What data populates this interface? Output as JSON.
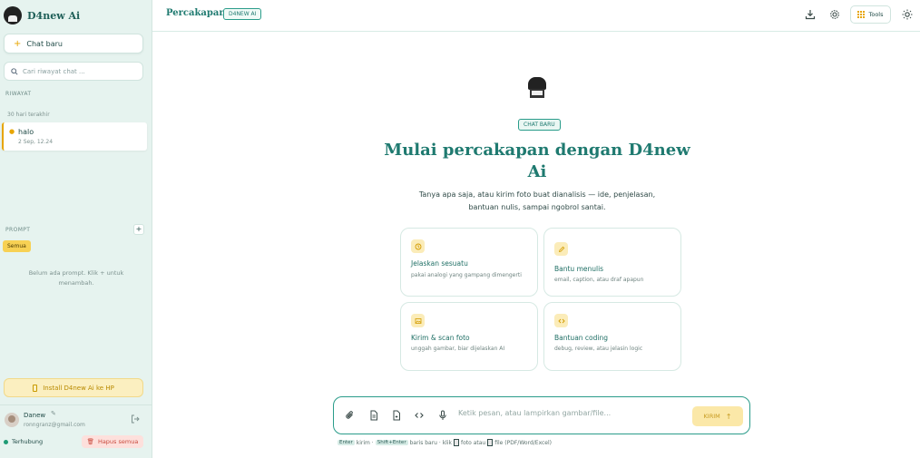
{
  "sidebar": {
    "brand": "D4new Ai",
    "new_chat": "Chat baru",
    "search_placeholder": "Cari riwayat chat ...",
    "history_label": "RIWAYAT",
    "group_label": "30 hari terakhir",
    "conversations": [
      {
        "title": "halo",
        "meta": "2 Sep, 12.24"
      }
    ],
    "prompt_label": "PROMPT",
    "prompt_add": "+",
    "prompt_filter": "Semua",
    "prompt_empty": "Belum ada prompt. Klik + untuk menambah.",
    "install": "Install D4new Ai ke HP",
    "user": {
      "name": "Danew",
      "email": "ronngranz@gmail.com"
    },
    "status": "Terhubung",
    "clear_all": "Hapus semua"
  },
  "topbar": {
    "title": "Percakapan",
    "badge": "D4NEW AI",
    "tools": "Tools",
    "icons": [
      "download-icon",
      "gear-icon",
      "sun-icon"
    ]
  },
  "hero": {
    "badge": "CHAT BARU",
    "title": "Mulai percakapan dengan D4new Ai",
    "subtitle": "Tanya apa saja, atau kirim foto buat dianalisis — ide, penjelasan, bantuan nulis, sampai ngobrol santai."
  },
  "cards": [
    {
      "title": "Jelaskan sesuatu",
      "desc": "pakai analogi yang gampang dimengerti",
      "icon": "clock-icon"
    },
    {
      "title": "Bantu menulis",
      "desc": "email, caption, atau draf apapun",
      "icon": "pencil-icon"
    },
    {
      "title": "Kirim & scan foto",
      "desc": "unggah gambar, biar dijelaskan AI",
      "icon": "image-icon"
    },
    {
      "title": "Bantuan coding",
      "desc": "debug, review, atau jelasin logic",
      "icon": "code-icon"
    }
  ],
  "composer": {
    "placeholder": "Ketik pesan, atau lampirkan gambar/file...",
    "send": "KIRIM",
    "icons": [
      "paperclip-icon",
      "document-icon",
      "file-icon",
      "code-icon",
      "mic-icon"
    ]
  },
  "hint": {
    "enter": "Enter",
    "send_text": "kirim ·",
    "shift_enter": "Shift+Enter",
    "newline_text": "baris baru · klik",
    "photo_text": "foto atau",
    "file_text": "file (PDF/Word/Excel)"
  },
  "colors": {
    "accent": "#1f7a70",
    "yellow": "#e7a500",
    "sidebar_bg": "#e6f3ef"
  }
}
